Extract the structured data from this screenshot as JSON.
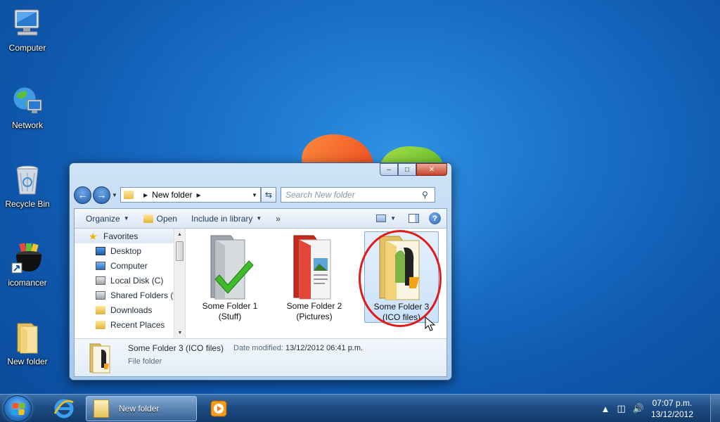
{
  "desktop": {
    "icons": [
      {
        "label": "Computer"
      },
      {
        "label": "Network"
      },
      {
        "label": "Recycle Bin"
      },
      {
        "label": "icomancer"
      },
      {
        "label": "New folder"
      }
    ]
  },
  "explorer": {
    "caption": {
      "minimize": "–",
      "maximize": "□",
      "close": "✕"
    },
    "address": {
      "crumb": "New folder"
    },
    "search": {
      "placeholder": "Search New folder"
    },
    "toolbar": {
      "organize": "Organize",
      "open": "Open",
      "include": "Include in library",
      "more": "»"
    },
    "nav_pane": {
      "favorites": "Favorites",
      "items": [
        "Desktop",
        "Computer",
        "Local Disk (C)",
        "Shared Folders (v",
        "Downloads",
        "Recent Places"
      ]
    },
    "files": [
      {
        "line1": "Some Folder 1",
        "line2": "(Stuff)"
      },
      {
        "line1": "Some Folder 2",
        "line2": "(Pictures)"
      },
      {
        "line1": "Some Folder 3",
        "line2": "(ICO files)",
        "selected": true
      }
    ],
    "details": {
      "name": "Some Folder 3 (ICO files)",
      "modified_label": "Date modified:",
      "modified_value": "13/12/2012 06:41 p.m.",
      "type": "File folder"
    }
  },
  "taskbar": {
    "task_label": "New folder",
    "time": "07:07 p.m.",
    "date": "13/12/2012"
  },
  "colors": {
    "highlight_ring": "#e01a1a",
    "selection": "#cbe2fa"
  }
}
